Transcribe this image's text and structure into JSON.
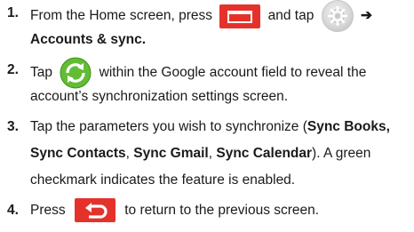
{
  "steps": [
    {
      "number": "1.",
      "lines": [
        {
          "a": "From the Home screen, press",
          "b": "and tap",
          "c": "➔"
        },
        {
          "bold": "Accounts & sync."
        }
      ],
      "icons": [
        "menu-icon",
        "settings-gear-icon"
      ]
    },
    {
      "number": "2.",
      "lines": [
        {
          "a": "Tap",
          "b": "within the Google account field to reveal the"
        },
        {
          "a": "account’s synchronization settings screen."
        }
      ],
      "icons": [
        "sync-icon"
      ]
    },
    {
      "number": "3.",
      "lines": [
        {
          "a": "Tap the parameters you wish to synchronize (",
          "b1": "Sync Books,"
        },
        {
          "b1": "Sync Contacts",
          "s1": ", ",
          "b2": "Sync Gmail",
          "s2": ", ",
          "b3": "Sync Calendar",
          "s3": "). A green"
        },
        {
          "a": "checkmark indicates the feature is enabled."
        }
      ]
    },
    {
      "number": "4.",
      "lines": [
        {
          "a": "Press",
          "b": "to return to the previous screen."
        }
      ],
      "icons": [
        "back-icon"
      ]
    }
  ],
  "colors": {
    "menu_icon_bg": "#e4322b",
    "sync_icon": "#5ab52e"
  }
}
